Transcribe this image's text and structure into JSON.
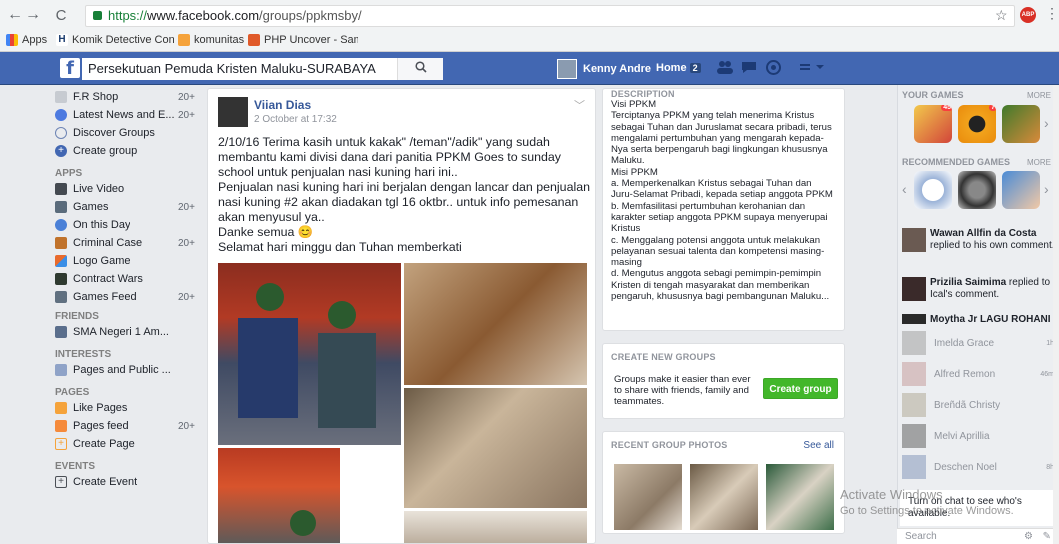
{
  "browser": {
    "back": "←",
    "forward": "→",
    "reload": "C",
    "url_scheme": "https://",
    "url_host": "www.facebook.com",
    "url_path": "/groups/ppkmsby/",
    "bookmarks": [
      "Apps",
      "Komik Detective Con",
      "komunitas",
      "PHP Uncover - Sampl"
    ]
  },
  "fbbar": {
    "search_value": "Persekutuan Pemuda Kristen Maluku-SURABAYA",
    "user_name": "Kenny Andre",
    "home_label": "Home",
    "home_count": "2"
  },
  "leftnav": {
    "top_items": [
      {
        "label": "F.R Shop",
        "count": "20+",
        "color": "#c7cbd1"
      },
      {
        "label": "Latest News and E...",
        "count": "20+",
        "color": "#4d7ae0"
      },
      {
        "label": "Discover Groups",
        "count": "",
        "color": "#6d84b4"
      },
      {
        "label": "Create group",
        "count": "",
        "color": "#4267b2"
      }
    ],
    "apps_heading": "APPS",
    "apps": [
      {
        "label": "Live Video",
        "count": "",
        "color": "#444950"
      },
      {
        "label": "Games",
        "count": "20+",
        "color": "#5a6b7b"
      },
      {
        "label": "On this Day",
        "count": "",
        "color": "#4a80d7"
      },
      {
        "label": "Criminal Case",
        "count": "20+",
        "color": "#c0722b"
      },
      {
        "label": "Logo Game",
        "count": "",
        "color": "#e86a2c"
      },
      {
        "label": "Contract Wars",
        "count": "",
        "color": "#2f3a30"
      },
      {
        "label": "Games Feed",
        "count": "20+",
        "color": "#607080"
      }
    ],
    "friends_heading": "FRIENDS",
    "friends": [
      {
        "label": "SMA Negeri 1 Am...",
        "color": "#5a6e8c"
      }
    ],
    "interests_heading": "INTERESTS",
    "interests": [
      {
        "label": "Pages and Public ...",
        "color": "#8fa3c8"
      }
    ],
    "pages_heading": "PAGES",
    "pages": [
      {
        "label": "Like Pages",
        "count": "",
        "color": "#f5a33b"
      },
      {
        "label": "Pages feed",
        "count": "20+",
        "color": "#f58a3b"
      },
      {
        "label": "Create Page",
        "count": "",
        "color": "#f5a33b"
      }
    ],
    "events_heading": "EVENTS",
    "events": [
      {
        "label": "Create Event",
        "color": "#4b4f56"
      }
    ]
  },
  "post": {
    "author": "Viian Dias",
    "time": "2 October at 17:32",
    "lines": [
      "2/10/16 Terima kasih untuk kakak\" /teman\"/adik\" yang sudah membantu kami divisi dana dari panitia PPKM Goes to sunday school untuk penjualan nasi kuning hari ini..",
      "Penjualan nasi kuning hari ini berjalan dengan lancar dan penjualan nasi kuning #2 akan diadakan tgl 16 oktbr.. untuk info pemesanan akan menyusul ya..",
      "Danke semua 😊",
      "Selamat hari minggu dan Tuhan memberkati"
    ]
  },
  "description": {
    "title": "DESCRIPTION",
    "lines": [
      "Visi PPKM",
      "Terciptanya PPKM yang telah menerima Kristus sebagai Tuhan dan Juruslamat secara pribadi, terus mengalami pertumbuhan yang mengarah kepada- Nya serta berpengaruh bagi lingkungan khususnya Maluku.",
      "Misi PPKM",
      "a. Memperkenalkan Kristus sebagai Tuhan dan Juru-Selamat Pribadi, kepada setiap anggota PPKM",
      "b. Memfasilitasi pertumbuhan kerohanian dan karakter setiap anggota PPKM supaya menyerupai Kristus",
      "c. Menggalang potensi anggota untuk melakukan pelayanan sesuai talenta dan kompetensi masing-masing",
      "d. Mengutus anggota sebagi pemimpin-pemimpin Kristen di tengah masyarakat dan memberikan pengaruh, khususnya bagi pembangunan Maluku..."
    ]
  },
  "create_groups": {
    "title": "CREATE NEW GROUPS",
    "text": "Groups make it easier than ever to share with friends, family and teammates.",
    "button": "Create group"
  },
  "recent_photos": {
    "title": "RECENT GROUP PHOTOS",
    "see_all": "See all"
  },
  "right": {
    "your_games": "YOUR GAMES",
    "more1": "MORE",
    "recommended": "RECOMMENDED GAMES",
    "more2": "MORE",
    "badge1": "45",
    "badge2": "7",
    "notifications": [
      {
        "name": "Wawan Allfin da Costa",
        "text": " replied to his own comment."
      },
      {
        "name": "Prizilia Saimima",
        "text": " replied to Ical's comment."
      },
      {
        "name": "Moytha Jr LAGU ROHANI",
        "text": ""
      }
    ],
    "contacts": [
      {
        "name": "Imelda Grace",
        "time": "1h"
      },
      {
        "name": "Alfred Remon",
        "time": "46m"
      },
      {
        "name": "Breñdã Christy",
        "time": ""
      },
      {
        "name": "Melvi Aprillia",
        "time": ""
      },
      {
        "name": "Deschen Noel",
        "time": "8h"
      }
    ],
    "chat_banner": "Turn on chat to see who's available.",
    "search_placeholder": "Search"
  },
  "watermark": {
    "line1": "Activate Windows",
    "line2": "Go to Settings to activate Windows."
  }
}
